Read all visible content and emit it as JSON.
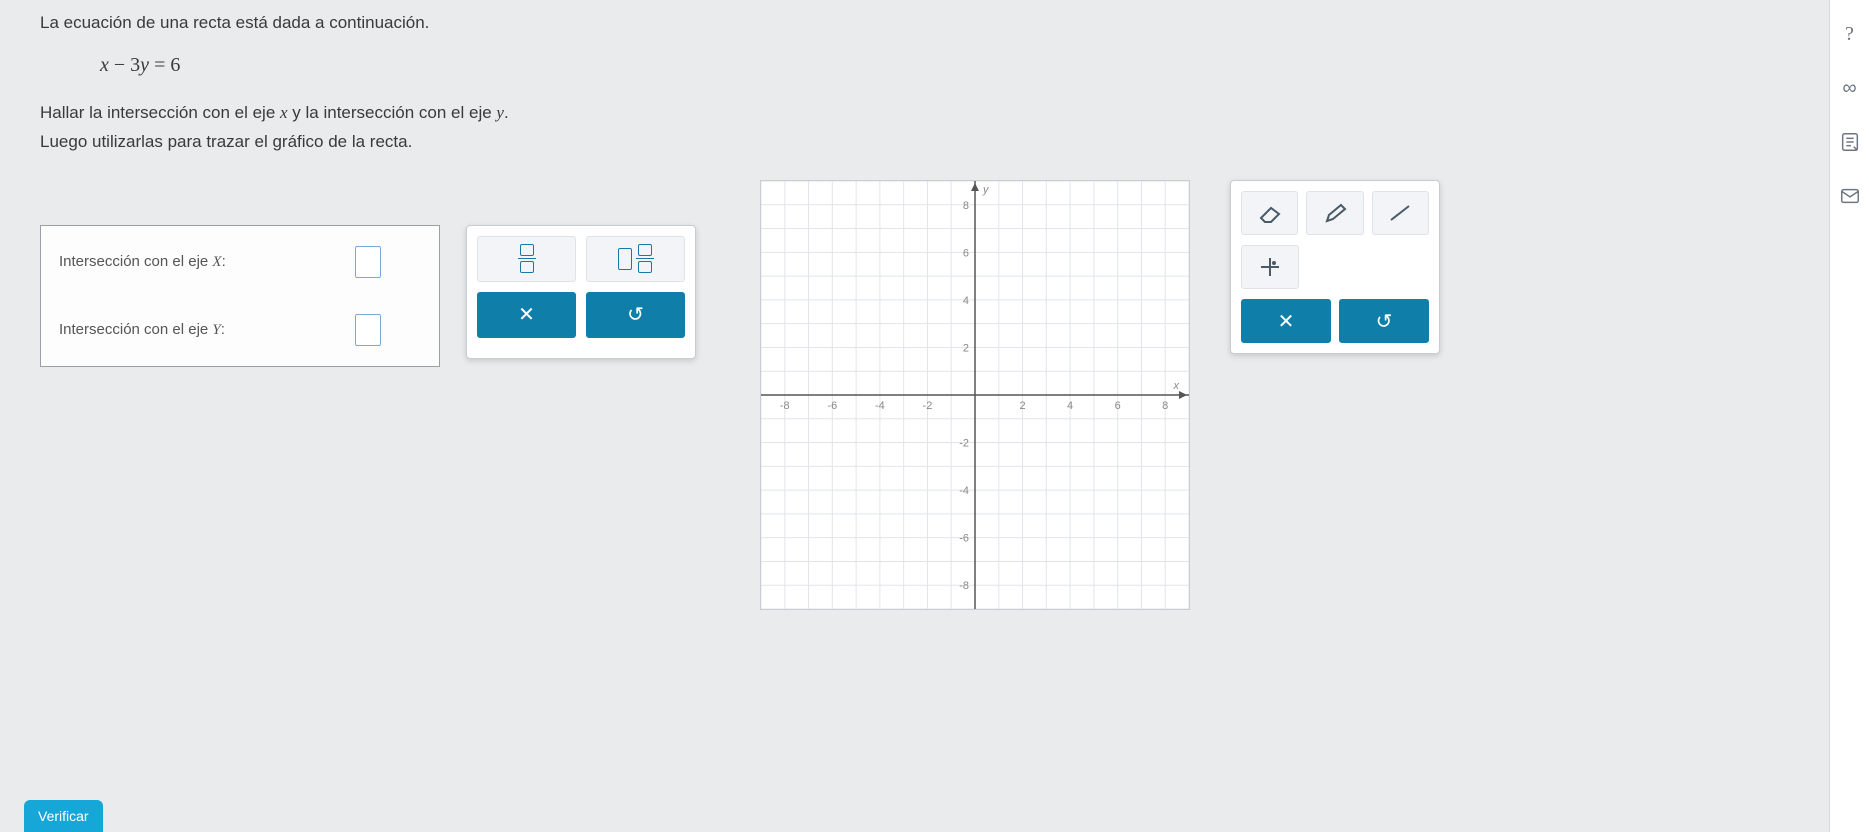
{
  "problem": {
    "line1": "La ecuación de una recta está dada a continuación.",
    "equation_prefix_var1": "x",
    "equation_mid": " − 3",
    "equation_var2": "y",
    "equation_rhs": " = 6",
    "line2_a": "Hallar la intersección con el eje ",
    "line2_var1": "x",
    "line2_b": " y la intersección con el eje ",
    "line2_var2": "y",
    "line2_c": ".",
    "line3": "Luego utilizarlas para trazar el gráfico de la recta."
  },
  "answer_box": {
    "x_label_a": "Intersección con el eje ",
    "x_label_var": "X",
    "x_label_b": ":",
    "y_label_a": "Intersección con el eje ",
    "y_label_var": "Y",
    "y_label_b": ":",
    "x_value": "",
    "y_value": ""
  },
  "keypad": {
    "clear_label": "✕",
    "undo_label": "↺"
  },
  "toolbox": {
    "clear_label": "✕",
    "undo_label": "↺"
  },
  "verify_label": "Verificar",
  "chart_data": {
    "type": "scatter",
    "title": "",
    "xlabel": "x",
    "ylabel": "y",
    "xlim": [
      -9,
      9
    ],
    "ylim": [
      -9,
      9
    ],
    "x_ticks": [
      -8,
      -6,
      -4,
      -2,
      2,
      4,
      6,
      8
    ],
    "y_ticks": [
      -8,
      -6,
      -4,
      -2,
      2,
      4,
      6,
      8
    ],
    "series": []
  }
}
